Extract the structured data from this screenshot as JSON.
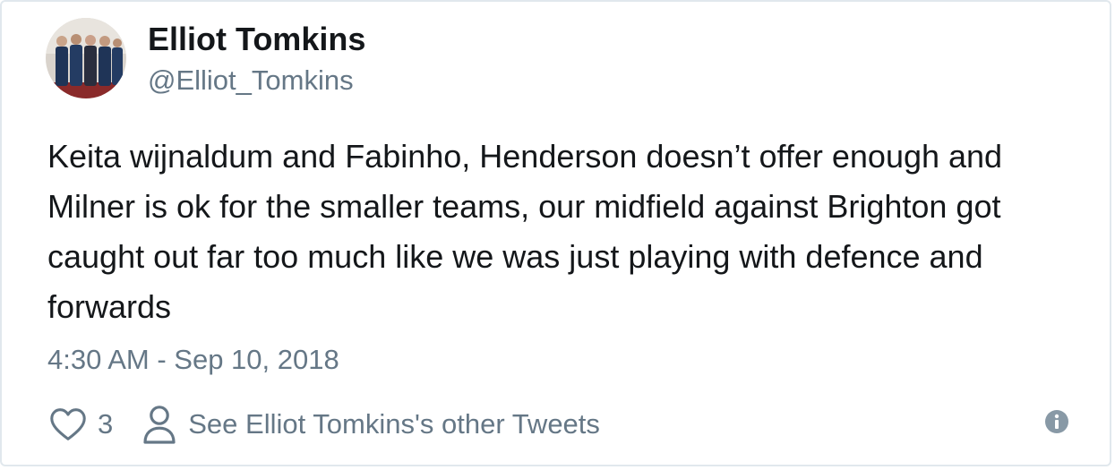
{
  "author": {
    "display_name": "Elliot Tomkins",
    "handle": "@Elliot_Tomkins"
  },
  "tweet": {
    "text": "Keita wijnaldum and Fabinho, Henderson doesn’t offer enough and Milner is ok for the smaller teams, our midfield against Brighton got caught out far too much like we was just playing with defence and forwards",
    "timestamp": "4:30 AM - Sep 10, 2018"
  },
  "actions": {
    "like_count": "3",
    "profile_link_label": "See Elliot Tomkins's other Tweets"
  },
  "icons": {
    "like": "heart-icon",
    "profile": "person-icon",
    "info": "info-icon"
  },
  "colors": {
    "text_primary": "#14171a",
    "text_secondary": "#657786",
    "border": "#e1e8ed"
  }
}
